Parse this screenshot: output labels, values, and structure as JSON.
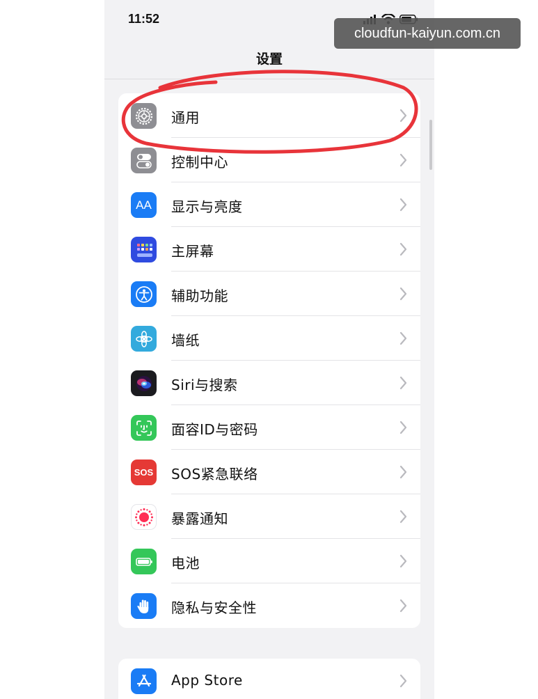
{
  "status_bar": {
    "time": "11:52"
  },
  "nav": {
    "title": "设置"
  },
  "watermark": "cloudfun-kaiyun.com.cn",
  "settings_main": [
    {
      "label": "通用",
      "icon": "gear-icon",
      "color": "#8e8e93"
    },
    {
      "label": "控制中心",
      "icon": "switches-icon",
      "color": "#8e8e93"
    },
    {
      "label": "显示与亮度",
      "icon": "aa-icon",
      "color": "#1a7cf5",
      "icon_text": "AA"
    },
    {
      "label": "主屏幕",
      "icon": "home-grid-icon",
      "color": "#2f4be0"
    },
    {
      "label": "辅助功能",
      "icon": "accessibility-icon",
      "color": "#1a7cf5"
    },
    {
      "label": "墙纸",
      "icon": "flower-icon",
      "color": "#33aadd"
    },
    {
      "label": "Siri与搜索",
      "icon": "siri-icon",
      "color": "#1b1b1f"
    },
    {
      "label": "面容ID与密码",
      "icon": "face-id-icon",
      "color": "#34c759"
    },
    {
      "label": "SOS紧急联络",
      "icon": "sos-icon",
      "color": "#e53935",
      "icon_text": "SOS"
    },
    {
      "label": "暴露通知",
      "icon": "exposure-icon",
      "color": "#ffffff"
    },
    {
      "label": "电池",
      "icon": "battery-icon",
      "color": "#34c759"
    },
    {
      "label": "隐私与安全性",
      "icon": "hand-icon",
      "color": "#1a7cf5"
    }
  ],
  "settings_store": [
    {
      "label": "App Store",
      "icon": "app-store-icon",
      "color": "#1a7cf5"
    }
  ],
  "colors": {
    "annotation": "#e8343a",
    "background": "#f2f2f4"
  }
}
